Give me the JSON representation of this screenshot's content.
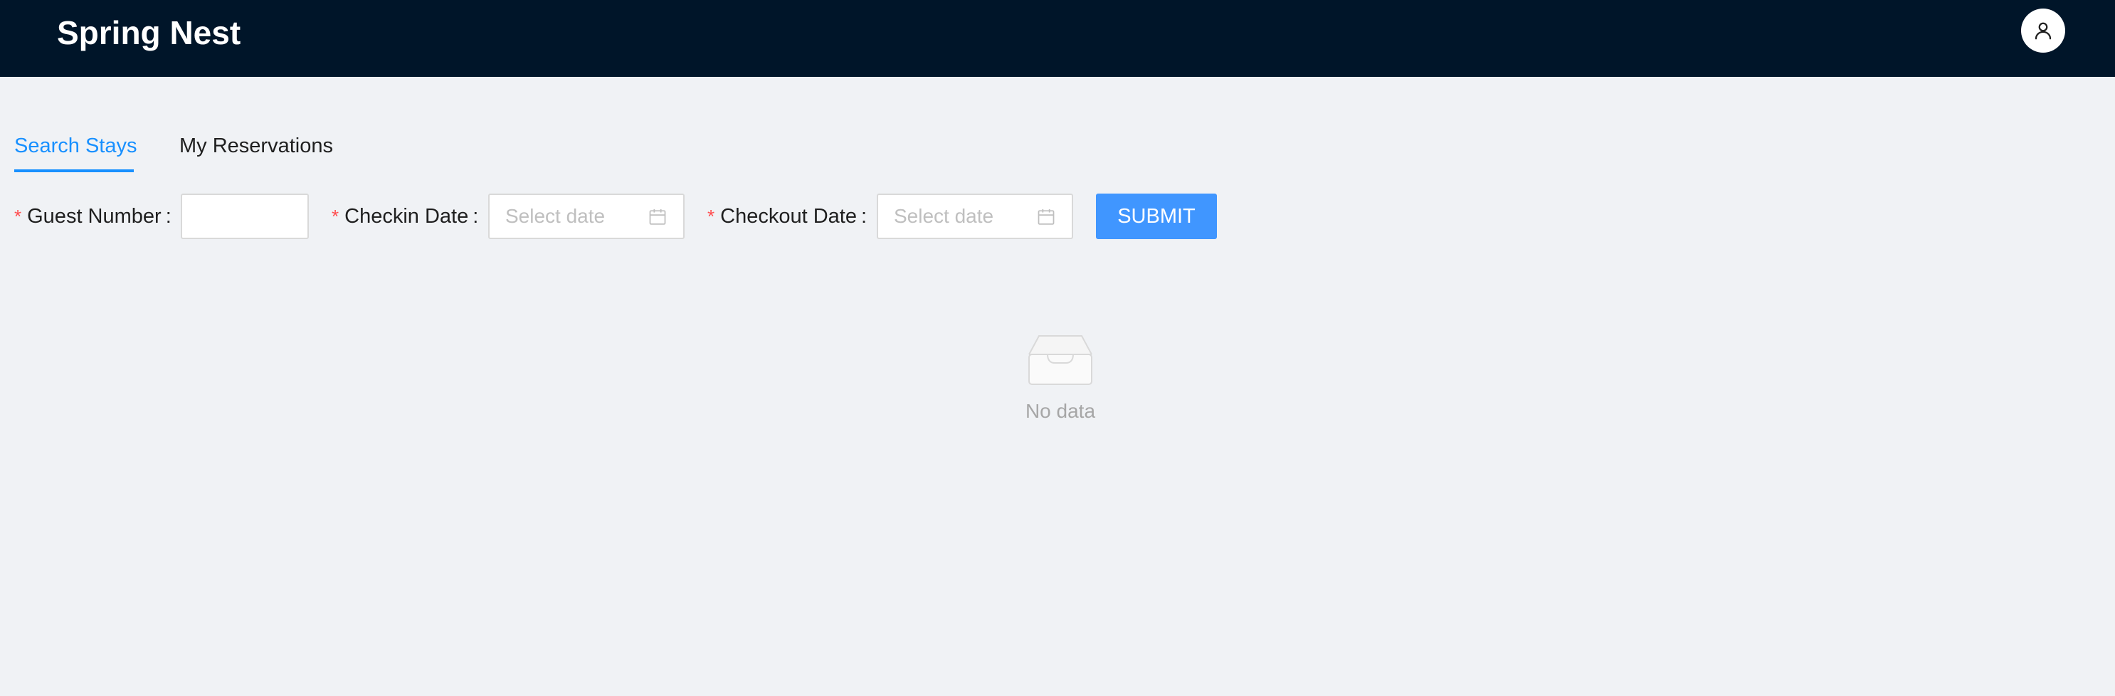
{
  "header": {
    "app_title": "Spring Nest",
    "avatar_icon": "user-icon"
  },
  "tabs": [
    {
      "label": "Search Stays",
      "active": true
    },
    {
      "label": "My Reservations",
      "active": false
    }
  ],
  "form": {
    "guest_number": {
      "label": "Guest Number",
      "required_mark": "*",
      "colon": ":",
      "value": "",
      "placeholder": ""
    },
    "checkin_date": {
      "label": "Checkin Date",
      "required_mark": "*",
      "colon": ":",
      "value": "",
      "placeholder": "Select date",
      "icon": "calendar-icon"
    },
    "checkout_date": {
      "label": "Checkout Date",
      "required_mark": "*",
      "colon": ":",
      "value": "",
      "placeholder": "Select date",
      "icon": "calendar-icon"
    },
    "submit_label": "SUBMIT"
  },
  "empty_state": {
    "icon": "empty-inbox-icon",
    "text": "No data"
  },
  "colors": {
    "header_bg": "#001529",
    "page_bg": "#f0f2f5",
    "accent": "#1890ff",
    "button": "#4096ff",
    "required": "#ff4d4f"
  }
}
